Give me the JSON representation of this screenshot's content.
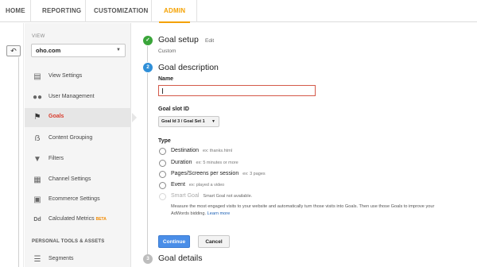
{
  "nav": {
    "tabs": [
      {
        "label": "HOME"
      },
      {
        "label": "REPORTING"
      },
      {
        "label": "CUSTOMIZATION"
      },
      {
        "label": "ADMIN",
        "active": true
      }
    ]
  },
  "sidebar": {
    "view_label": "VIEW",
    "view_value": "oho.com",
    "items": [
      {
        "label": "View Settings",
        "icon": "document-icon"
      },
      {
        "label": "User Management",
        "icon": "users-icon"
      },
      {
        "label": "Goals",
        "icon": "flag-icon",
        "active": true
      },
      {
        "label": "Content Grouping",
        "icon": "grouping-icon"
      },
      {
        "label": "Filters",
        "icon": "filter-icon"
      },
      {
        "label": "Channel Settings",
        "icon": "channel-icon"
      },
      {
        "label": "Ecommerce Settings",
        "icon": "cart-icon"
      },
      {
        "label": "Calculated Metrics",
        "icon": "dd-icon",
        "badge": "BETA"
      }
    ],
    "section_title": "PERSONAL TOOLS & ASSETS",
    "section_items": [
      {
        "label": "Segments",
        "icon": "segments-icon"
      }
    ]
  },
  "goal_setup": {
    "title": "Goal setup",
    "edit_label": "Edit",
    "subtitle": "Custom"
  },
  "goal_description": {
    "step_number": "2",
    "title": "Goal description",
    "name_label": "Name",
    "name_value": "",
    "slot_label": "Goal slot ID",
    "slot_value": "Goal Id 3 / Goal Set 1",
    "type_label": "Type",
    "types": [
      {
        "label": "Destination",
        "example": "ex: thanks.html"
      },
      {
        "label": "Duration",
        "example": "ex: 5 minutes or more"
      },
      {
        "label": "Pages/Screens per session",
        "example": "ex: 3 pages"
      },
      {
        "label": "Event",
        "example": "ex: played a video"
      },
      {
        "label": "Smart Goal",
        "example": "Smart Goal not available.",
        "disabled": true
      }
    ],
    "smart_desc": "Measure the most engaged visits to your website and automatically turn those visits into Goals. Then use those Goals to improve your AdWords bidding.",
    "smart_link": "Learn more",
    "continue_label": "Continue",
    "cancel_label": "Cancel"
  },
  "goal_details": {
    "step_number": "3",
    "title": "Goal details"
  },
  "colors": {
    "accent": "#f4a100",
    "active_item": "#d83b2c",
    "primary_button": "#4a8ee8",
    "check_green": "#3aa53a",
    "step_blue": "#2f8fd8",
    "step_gray": "#bdbdbd"
  }
}
